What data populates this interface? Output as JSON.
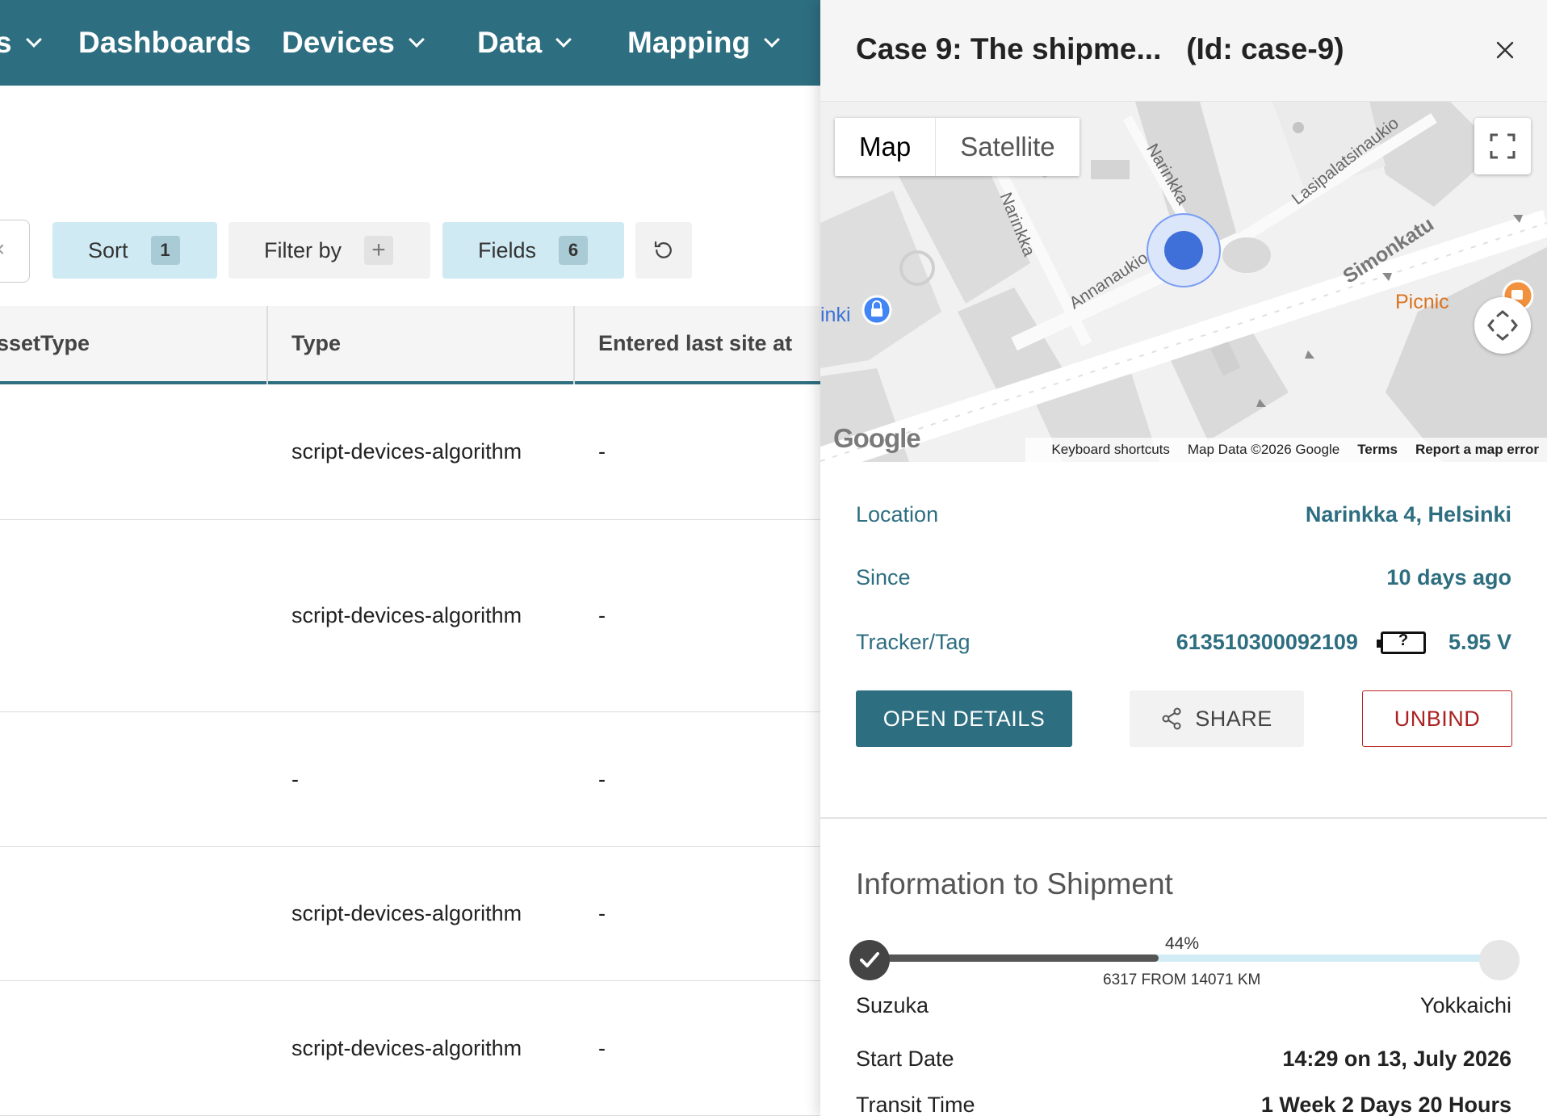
{
  "nav": {
    "items": [
      {
        "label": "s"
      },
      {
        "label": "Dashboards"
      },
      {
        "label": "Devices"
      },
      {
        "label": "Data"
      },
      {
        "label": "Mapping"
      }
    ]
  },
  "toolbar": {
    "search_clear": "×",
    "sort": {
      "label": "Sort",
      "count": "1"
    },
    "filter": {
      "label": "Filter by",
      "add": "+"
    },
    "fields": {
      "label": "Fields",
      "count": "6"
    }
  },
  "table": {
    "headers": [
      "ssetType",
      "Type",
      "Entered last site at"
    ],
    "rows": [
      {
        "type": "script-devices-algorithm",
        "entered": "-"
      },
      {
        "type": "script-devices-algorithm",
        "entered": "-"
      },
      {
        "type": "-",
        "entered": "-"
      },
      {
        "type": "script-devices-algorithm",
        "entered": "-"
      },
      {
        "type": "script-devices-algorithm",
        "entered": "-"
      }
    ]
  },
  "panel": {
    "title": "Case 9: The shipme...",
    "id_label": "(Id: case-9)",
    "map": {
      "tabs": [
        "Map",
        "Satellite"
      ],
      "streets": [
        "Narinkka",
        "Narinkka",
        "Lasipalatsinaukio",
        "Simonkatu",
        "Annanaukio",
        "inki"
      ],
      "poi": "Picnic",
      "google": "Google",
      "footer": {
        "shortcuts": "Keyboard shortcuts",
        "data": "Map Data ©2026 Google",
        "terms": "Terms",
        "report": "Report a map error"
      }
    },
    "info": {
      "location_label": "Location",
      "location_value": "Narinkka 4, Helsinki",
      "since_label": "Since",
      "since_value": "10 days ago",
      "tracker_label": "Tracker/Tag",
      "tracker_id": "613510300092109",
      "battery_symbol": "?",
      "voltage": "5.95 V"
    },
    "actions": {
      "open": "OPEN DETAILS",
      "share": "SHARE",
      "unbind": "UNBIND"
    },
    "shipment": {
      "title": "Information to Shipment",
      "progress_percent": 44,
      "progress_label": "44%",
      "distance_text": "6317 FROM 14071 KM",
      "origin": "Suzuka",
      "destination": "Yokkaichi",
      "start_date_label": "Start Date",
      "start_date_value": "14:29 on 13, July 2026",
      "transit_label": "Transit Time",
      "transit_value": "1 Week 2 Days 20 Hours"
    },
    "colors": {
      "accent": "#2d6e80",
      "danger": "#aa2222",
      "chip_blue": "#cfeaf3"
    }
  }
}
